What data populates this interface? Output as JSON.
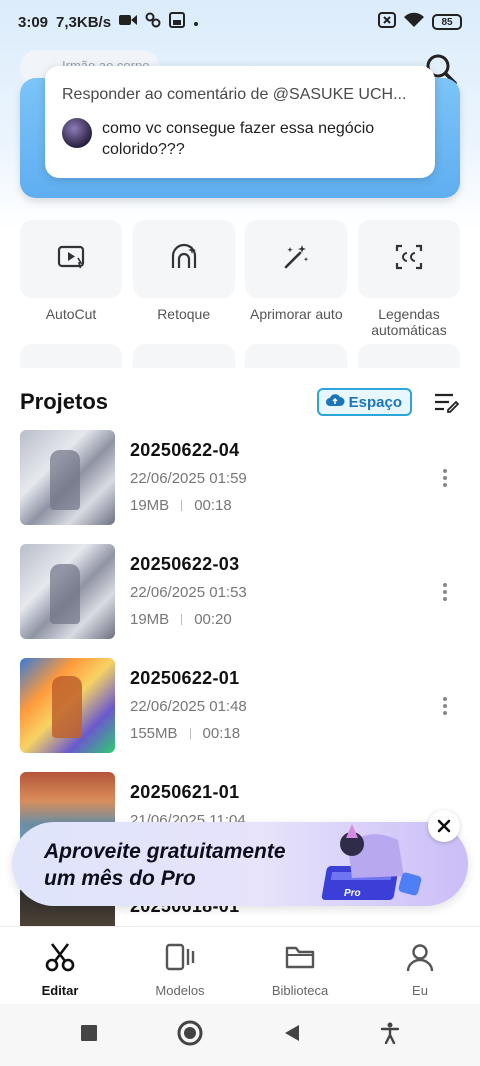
{
  "status_bar": {
    "time": "3:09",
    "network_speed": "7,3KB/s",
    "battery": "85"
  },
  "search": {
    "placeholder": "Irmão ao corpo"
  },
  "comment": {
    "reply_to": "Responder ao comentário de @SASUKE UCH...",
    "text": "como vc consegue fazer essa negócio colorido???"
  },
  "tools": [
    {
      "label": "AutoCut",
      "icon": "autocut-icon"
    },
    {
      "label": "Retoque",
      "icon": "retouch-icon"
    },
    {
      "label": "Aprimorar auto",
      "icon": "magic-wand-icon"
    },
    {
      "label": "Legendas automáticas",
      "icon": "captions-icon"
    }
  ],
  "projects": {
    "title": "Projetos",
    "space_label": "Espaço",
    "items": [
      {
        "name": "20250622-04",
        "date": "22/06/2025 01:59",
        "size": "19MB",
        "duration": "00:18"
      },
      {
        "name": "20250622-03",
        "date": "22/06/2025 01:53",
        "size": "19MB",
        "duration": "00:20"
      },
      {
        "name": "20250622-01",
        "date": "22/06/2025 01:48",
        "size": "155MB",
        "duration": "00:18"
      },
      {
        "name": "20250621-01",
        "date": "21/06/2025 11:04",
        "size": "",
        "duration": ""
      },
      {
        "name": "20250618-01",
        "date": "",
        "size": "",
        "duration": ""
      }
    ]
  },
  "promo": {
    "line1": "Aproveite gratuitamente",
    "line2": "um mês do Pro",
    "badge": "Pro"
  },
  "bottom_nav": [
    {
      "label": "Editar",
      "icon": "scissors-icon",
      "active": true
    },
    {
      "label": "Modelos",
      "icon": "templates-icon",
      "active": false
    },
    {
      "label": "Biblioteca",
      "icon": "folder-icon",
      "active": false
    },
    {
      "label": "Eu",
      "icon": "profile-icon",
      "active": false
    }
  ],
  "colors": {
    "accent": "#2aa6d9",
    "banner": "#6bb8f4",
    "promo": "#d9d2fa"
  }
}
